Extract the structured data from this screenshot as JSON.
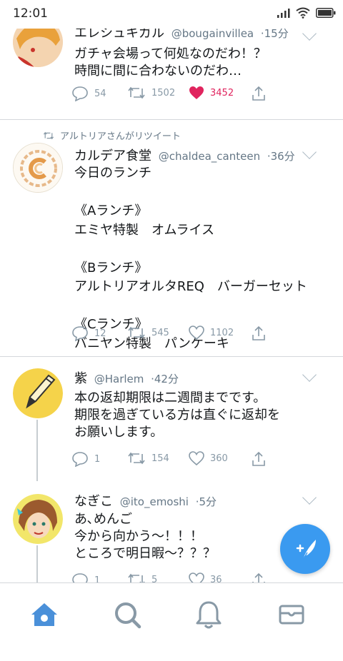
{
  "status": {
    "time": "12:01"
  },
  "tweets": [
    {
      "name": "エレシュキガル",
      "handle": "@bougainvillea",
      "time": "·15分",
      "text": "ガチャ会場って何処なのだわ！？\n時間に間に合わないのだわ…",
      "replies": "54",
      "retweets": "1502",
      "likes": "3452",
      "liked": true
    },
    {
      "retweeted_by": "アルトリアさんがリツイート",
      "name": "カルデア食堂",
      "handle": "@chaldea_canteen",
      "time": "·36分",
      "text": "今日のランチ\n\n《Aランチ》\nエミヤ特製　オムライス\n\n《Bランチ》\nアルトリアオルタREQ　バーガーセット\n\n《Cランチ》\nバニヤン特製　パンケーキ",
      "replies": "12",
      "retweets": "545",
      "likes": "1102",
      "liked": false
    },
    {
      "name": "紫",
      "handle": "@Harlem",
      "time": "·42分",
      "text": "本の返却期限は二週間までです。\n期限を過ぎている方は直ぐに返却を\nお願いします。",
      "replies": "1",
      "retweets": "154",
      "likes": "360",
      "liked": false
    },
    {
      "name": "なぎこ",
      "handle": "@ito_emoshi",
      "time": "·5分",
      "text": "あ､めんご\n今から向かう～！！！\nところで明日暇～？？？",
      "replies": "1",
      "retweets": "5",
      "likes": "36",
      "liked": false
    }
  ],
  "tabs": [
    "home-icon",
    "search-icon",
    "notifications-icon",
    "messages-icon"
  ],
  "colors": {
    "accent": "#3a9af0",
    "like": "#e0245e",
    "tab_active": "#4a90d9",
    "muted": "#8899a6"
  }
}
